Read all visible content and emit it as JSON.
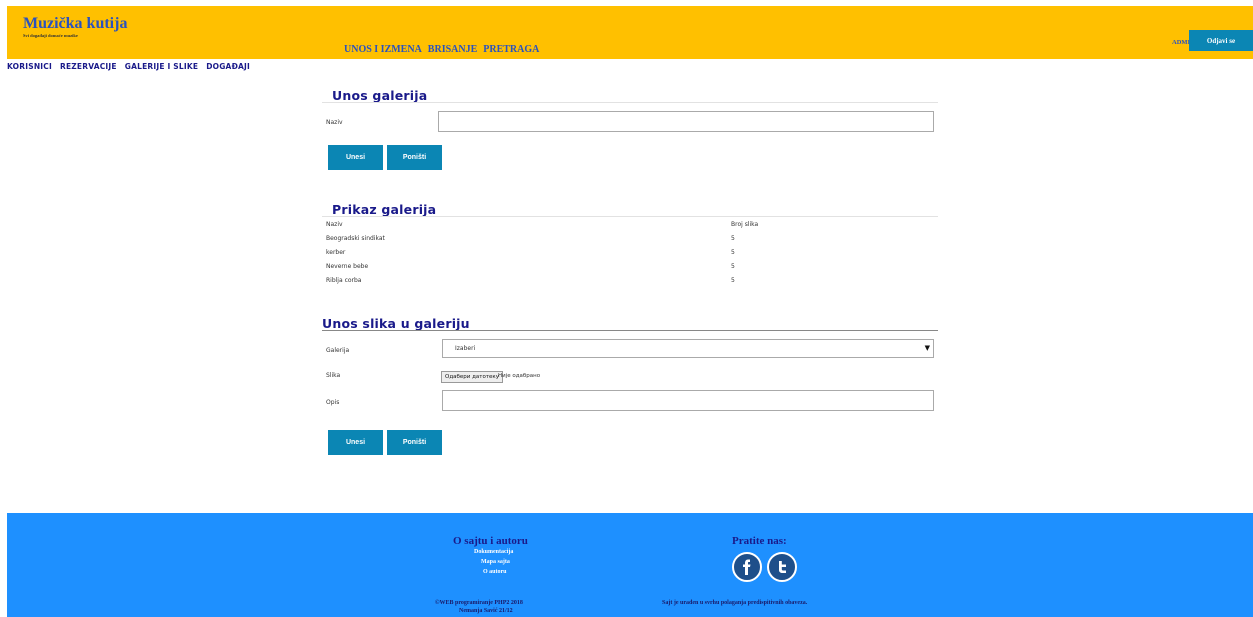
{
  "header": {
    "site_title": "Muzička kutija",
    "site_subtitle": "Svi događaji domaće muzike",
    "nav": [
      "UNOS I IZMENA",
      "BRISANJE",
      "PRETRAGA"
    ],
    "user": "ADMIN",
    "logout_label": "Odjavi se"
  },
  "subnav": [
    "KORISNICI",
    "REZERVACIJE",
    "GALERIJE I SLIKE",
    "DOGAĐAJI"
  ],
  "gallery_entry": {
    "title": "Unos galerija",
    "name_label": "Naziv",
    "name_value": "",
    "submit_label": "Unesi",
    "reset_label": "Poništi"
  },
  "gallery_list": {
    "title": "Prikaz galerija",
    "columns": [
      "Naziv",
      "Broj slika"
    ],
    "rows": [
      [
        "Beogradski sindikat",
        "5"
      ],
      [
        "kerber",
        "5"
      ],
      [
        "Neverne bebe",
        "5"
      ],
      [
        "Riblja corba",
        "5"
      ]
    ]
  },
  "image_entry": {
    "title": "Unos slika u galeriju",
    "gallery_label": "Galerija",
    "gallery_selected": "Izaberi",
    "image_label": "Slika",
    "file_button_label": "Одабери датотеку",
    "file_status": "Није одабрано",
    "desc_label": "Opis",
    "desc_value": "",
    "submit_label": "Unesi",
    "reset_label": "Poništi"
  },
  "footer": {
    "about_heading": "O sajtu i autoru",
    "about_links": [
      "Dokumentacija",
      "Mapa sajta",
      "O autoru"
    ],
    "follow_heading": "Pratite nas:",
    "social_icons": [
      "facebook-icon",
      "twitter-icon"
    ],
    "copyright_line1": "©WEB programiranje PHP2 2018",
    "copyright_line2": "Nemanja Savić 21/12",
    "note": "Sajt je urađen u svrhu polaganja predispitivnih obaveza."
  }
}
